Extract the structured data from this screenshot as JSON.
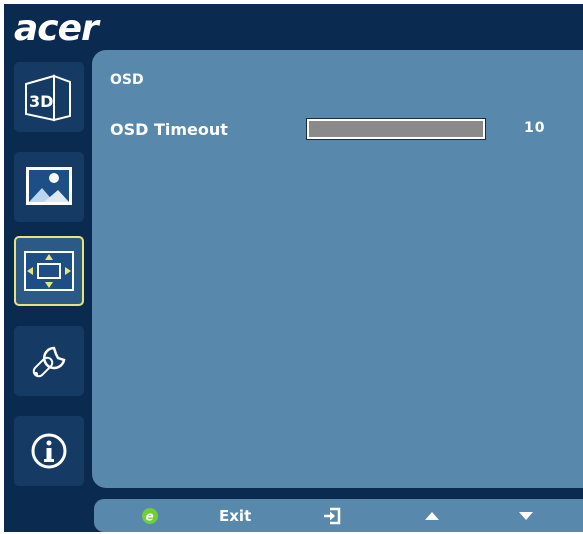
{
  "brand": {
    "logo_text": "acer"
  },
  "sidebar": {
    "items": [
      {
        "name": "3D",
        "icon": "3d-icon",
        "active": false
      },
      {
        "name": "Picture",
        "icon": "picture-icon",
        "active": false
      },
      {
        "name": "OSD",
        "icon": "osd-position-icon",
        "active": true
      },
      {
        "name": "Settings",
        "icon": "wrench-icon",
        "active": false
      },
      {
        "name": "Information",
        "icon": "info-icon",
        "active": false
      }
    ]
  },
  "panel": {
    "title": "OSD",
    "setting": {
      "label": "OSD Timeout",
      "value": "10",
      "fill_fraction": 1.0
    }
  },
  "bottom_bar": {
    "exit_label": "Exit",
    "icons": [
      "e-key-icon",
      "enter-icon",
      "up-arrow-icon",
      "down-arrow-icon"
    ]
  },
  "colors": {
    "frame_bg": "#0b2a4f",
    "panel_bg": "#5988ad",
    "active_border": "#e8e37a",
    "e_key": "#6fcf3a"
  }
}
